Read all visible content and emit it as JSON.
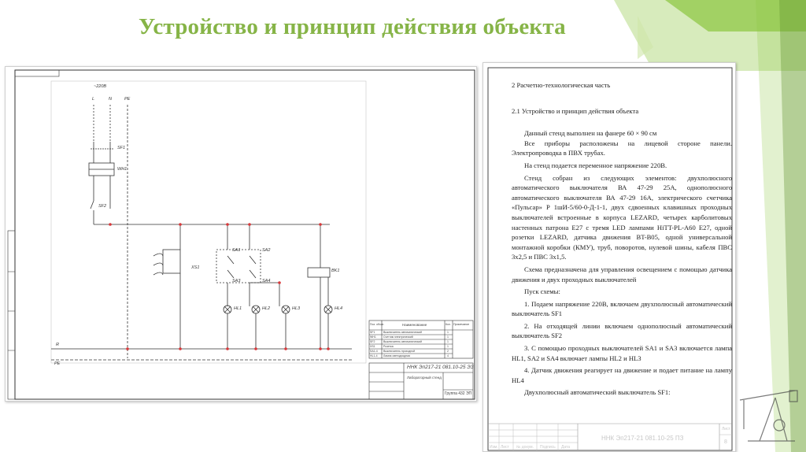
{
  "slide": {
    "title": "Устройство и принцип действия объекта"
  },
  "colors": {
    "title": "#86b447",
    "accent_green": "#8cc63f",
    "accent_dark_green": "#5e8e2a",
    "schematic_red": "#d9383a"
  },
  "schematic": {
    "supply_label": "~220В",
    "phase_labels": [
      "L",
      "N",
      "PE"
    ],
    "breakers": [
      "SF1",
      "WH1",
      "SF2"
    ],
    "switches": [
      "SA1",
      "SA2",
      "SA3",
      "SA4"
    ],
    "connector": "XS1",
    "sensor": "BK1",
    "lamps": [
      "HL1",
      "HL2",
      "HL3",
      "HL4"
    ],
    "bus_labels": [
      "R",
      "PE"
    ],
    "stamp": {
      "code": "ННК Эп217-21 081.10-25 ЭЗ",
      "sheet_title": "Лабораторный стенд",
      "group": "Группа 432 ЭП"
    },
    "spec_table": {
      "headers": [
        "Поз. обозн.",
        "Наименование",
        "Кол.",
        "Примечание"
      ],
      "rows": [
        {
          "pos": "SF1",
          "name": "Выключатель автоматический",
          "qty": "1"
        },
        {
          "pos": "WH1",
          "name": "Счетчик электрический",
          "qty": "1"
        },
        {
          "pos": "SF2",
          "name": "Выключатель автоматический",
          "qty": "1"
        },
        {
          "pos": "XS1",
          "name": "Розетка",
          "qty": "1"
        },
        {
          "pos": "SA1-4",
          "name": "Выключатель проходной",
          "qty": "2"
        },
        {
          "pos": "HL1-4",
          "name": "Лампа светодиодная",
          "qty": "4"
        }
      ]
    }
  },
  "document": {
    "section_heading": "2 Расчетно-технологическая часть",
    "subsection_heading": "2.1 Устройство и принцип действия объекта",
    "paragraphs": [
      "Данный стенд выполнен на фанере 60 × 90 см",
      "Все приборы расположены на лицевой стороне панели. Электропроводка в ПВХ трубах.",
      "На стенд подается переменное напряжение 220В.",
      "Стенд собран из следующих элементов: двухполюсного автоматического выключателя ВА 47-29 25А, однополюсного автоматического выключателя ВА 47-29 16А, электрического счетчика «Пульсар» Р 1шИ-5/60-0-Д-1-1, двух сдвоенных клавишных проходных выключателей встроенные в корпуса LEZARD, четырех карболитовых настенных патрона Е27 с тремя LED лампами HiTT-PL-A60 E27, одной розетки LEZARD, датчика движения BT-B05, одной универсальной монтажной коробки (КМУ), труб, поворотов, нулевой шины, кабеля ПВС 3х2,5 и ПВС 3х1,5.",
      "Схема предназначена для управления освещением с помощью датчика движения и двух проходных выключателей",
      "Пуск схемы:",
      "1. Подаем напряжение 220В, включаем двухполюсный автоматический выключатель SF1",
      "2. На отходящей линии включаем однополюсный автоматический выключатель SF2",
      "3. С помощью проходных выключателей SA1 и SA3 включается лампа HL1, SA2 и SA4 включает лампы HL2 и HL3",
      "4. Датчик движения реагирует на движение и подает питание на лампу HL4",
      "Двухполюсный автоматический выключатель SF1:"
    ],
    "stamp_code": "ННК Эп217-21 081.10-25 ПЗ",
    "stamp_labels": [
      "Изм.",
      "Лист",
      "№ докум.",
      "Подпись",
      "Дата"
    ],
    "sheet_label": "Лист",
    "sheet_number": "8"
  }
}
